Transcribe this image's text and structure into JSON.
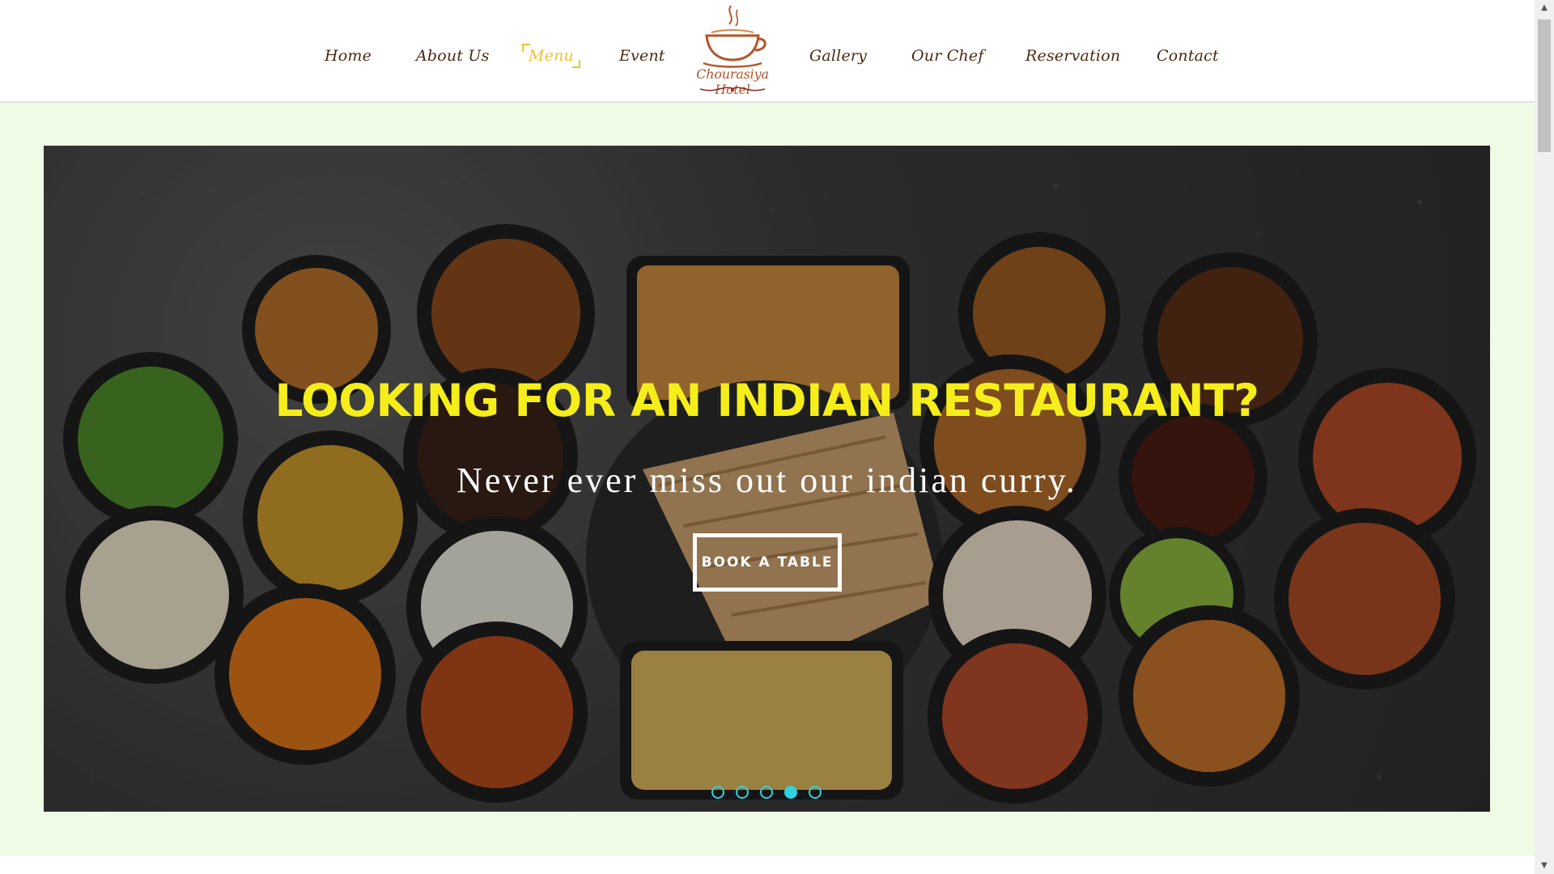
{
  "nav": {
    "left": [
      "Home",
      "About Us",
      "Menu",
      "Event"
    ],
    "right": [
      "Gallery",
      "Our Chef",
      "Reservation",
      "Contact"
    ],
    "active": "Menu"
  },
  "logo": {
    "text": "Chourasiya Hotel",
    "icon": "teacup-icon"
  },
  "hero": {
    "title": "LOOKING FOR AN INDIAN RESTAURANT?",
    "subtitle": "Never ever miss out our indian curry.",
    "button": "BOOK A TABLE",
    "slides_total": 5,
    "slide_active": 4
  },
  "colors": {
    "accent": "#f2c22e",
    "title": "#f5ee1b",
    "nav_text": "#4a2a12",
    "page_bg": "#f0fbe6",
    "dot": "#2fd3e0"
  }
}
